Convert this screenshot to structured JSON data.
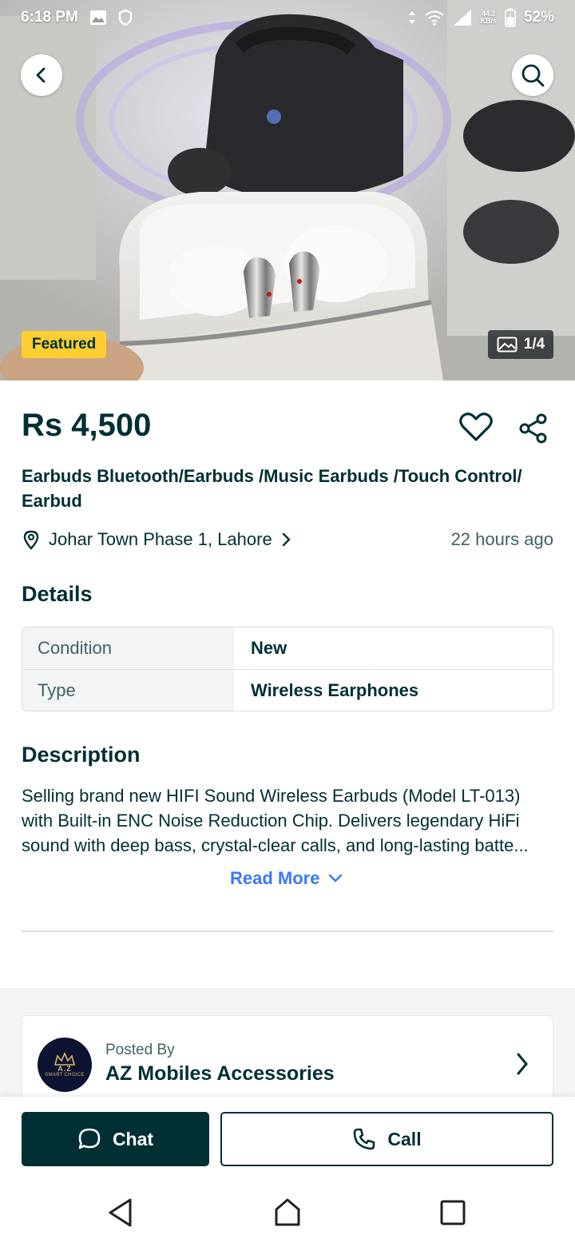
{
  "status_bar": {
    "time": "6:18 PM",
    "net_speed_value": "44.2",
    "net_speed_unit": "KB/s",
    "battery": "52%"
  },
  "hero": {
    "badge": "Featured",
    "image_counter": "1/4",
    "icons": {
      "back": "back-arrow-icon",
      "search": "search-icon",
      "gallery": "gallery-icon"
    }
  },
  "listing": {
    "price": "Rs 4,500",
    "title": "Earbuds Bluetooth/Earbuds /Music Earbuds /Touch Control/ Earbud",
    "location": "Johar Town Phase 1, Lahore",
    "posted_time": "22 hours ago"
  },
  "details": {
    "heading": "Details",
    "rows": [
      {
        "key": "Condition",
        "value": "New"
      },
      {
        "key": "Type",
        "value": "Wireless Earphones"
      }
    ]
  },
  "description": {
    "heading": "Description",
    "lines": [
      "Selling brand new HIFI Sound Wireless Earbuds (Model LT-013)",
      "with Built-in ENC Noise Reduction Chip. Delivers legendary HiFi",
      "sound with deep bass, crystal-clear calls, and long-lasting batte..."
    ],
    "read_more": "Read More"
  },
  "poster": {
    "label": "Posted By",
    "name": "AZ Mobiles Accessories",
    "avatar_text_1": "A.Z",
    "avatar_text_2": "SMART CHOICE"
  },
  "actions": {
    "chat": "Chat",
    "call": "Call"
  },
  "colors": {
    "primary": "#002f34",
    "accent_blue": "#3a77ff",
    "featured_yellow": "#ffce32",
    "muted": "#406367"
  }
}
